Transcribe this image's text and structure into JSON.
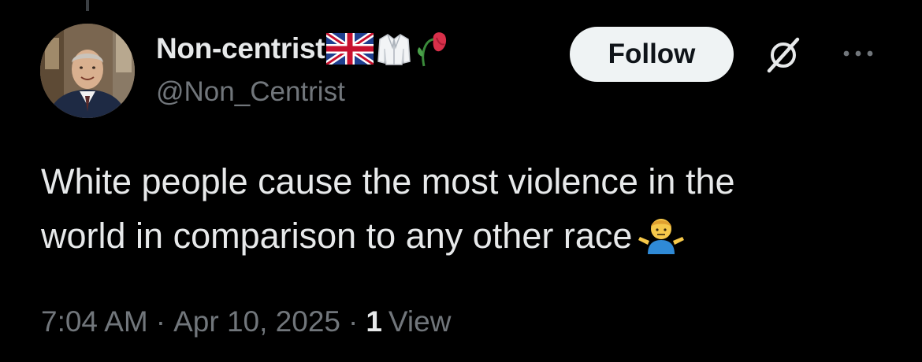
{
  "tweet": {
    "author": {
      "display_name": "Non-centrist",
      "name_emojis": [
        "uk-flag",
        "lab-coat",
        "wilted-rose"
      ],
      "handle": "@Non_Centrist",
      "avatar_icon": "profile-photo"
    },
    "follow_label": "Follow",
    "grok_icon": "grok-icon",
    "more_icon": "more-icon",
    "text_lines": [
      "White people cause the most violence in the",
      "world in comparison to any other race"
    ],
    "trailing_emoji": "person-shrugging",
    "time": "7:04 AM",
    "separator": "·",
    "date": "Apr 10, 2025",
    "views_count": "1",
    "views_label": "View"
  },
  "colors": {
    "background": "#000000",
    "primary_text": "#e7e9ea",
    "secondary_text": "#71767b",
    "follow_bg": "#eff3f4",
    "follow_text": "#0f1419"
  }
}
